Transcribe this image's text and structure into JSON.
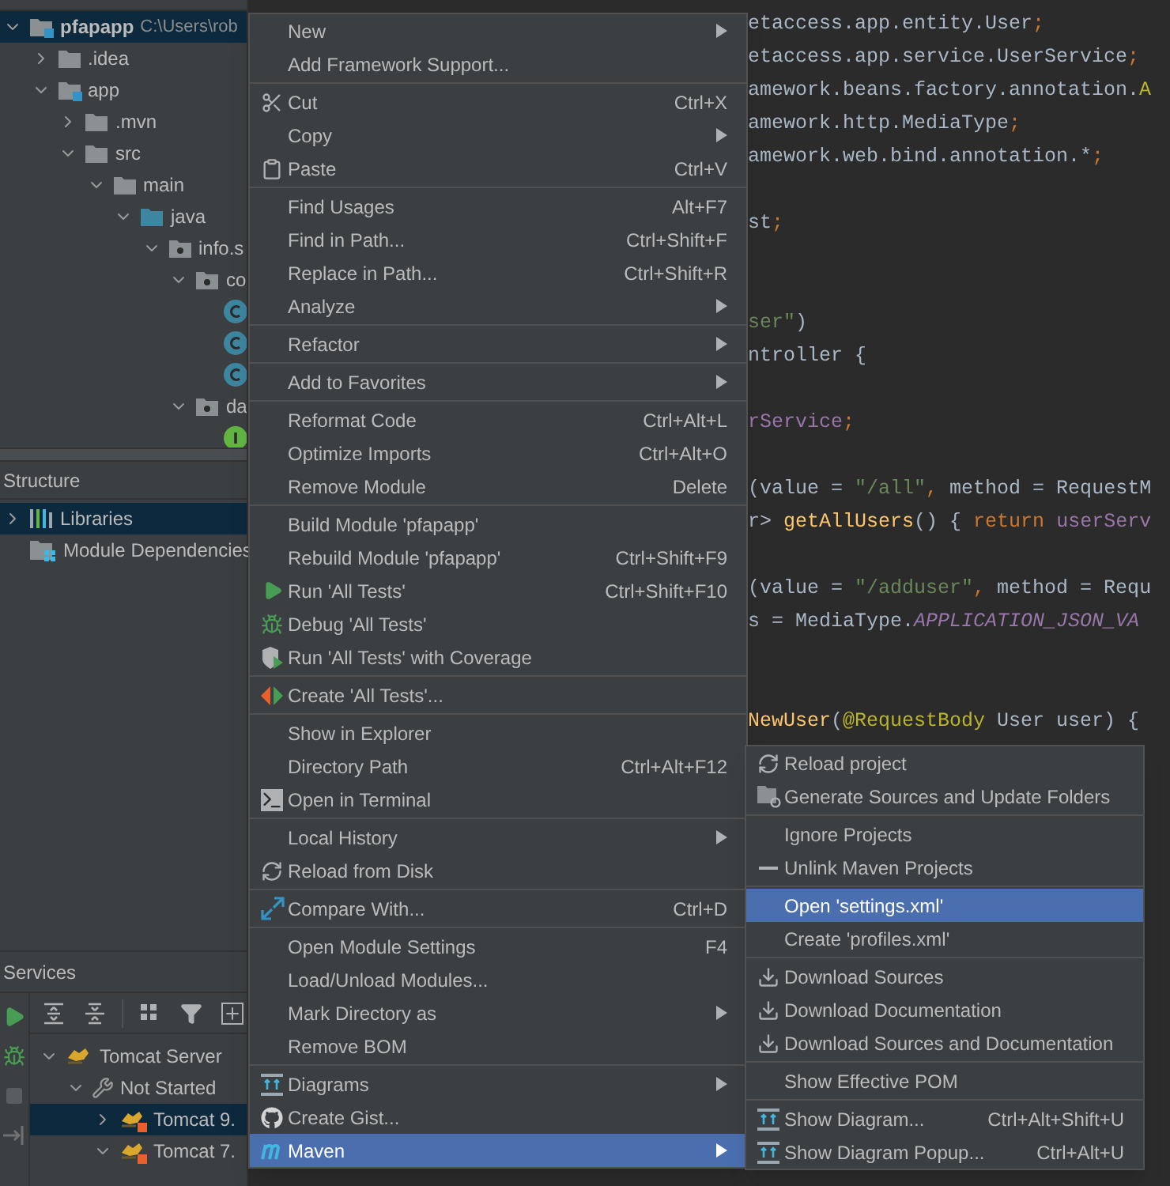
{
  "project_tree": {
    "items": [
      {
        "label": "pfapapp",
        "path": "C:\\Users\\rob",
        "kind": "module",
        "expanded": true,
        "selected": true,
        "children": [
          {
            "label": ".idea",
            "kind": "folder",
            "expanded": false,
            "selected": false
          },
          {
            "label": "app",
            "kind": "module",
            "expanded": true,
            "selected": false,
            "children": [
              {
                "label": ".mvn",
                "kind": "folder",
                "expanded": false,
                "selected": false
              },
              {
                "label": "src",
                "kind": "folder",
                "expanded": true,
                "selected": false,
                "children": [
                  {
                    "label": "main",
                    "kind": "folder",
                    "expanded": true,
                    "selected": false,
                    "children": [
                      {
                        "label": "java",
                        "kind": "source_root",
                        "expanded": true,
                        "selected": false,
                        "children": [
                          {
                            "label": "info.s",
                            "kind": "package",
                            "expanded": true,
                            "selected": false,
                            "children": [
                              {
                                "label": "co",
                                "kind": "package",
                                "expanded": true,
                                "selected": false,
                                "children": [
                                  {
                                    "kind": "class",
                                    "selected": false
                                  },
                                  {
                                    "kind": "class",
                                    "selected": false
                                  },
                                  {
                                    "kind": "class",
                                    "selected": false
                                  }
                                ]
                              },
                              {
                                "label": "da",
                                "kind": "package",
                                "expanded": true,
                                "selected": false,
                                "children": [
                                  {
                                    "kind": "interface",
                                    "selected": false
                                  }
                                ]
                              }
                            ]
                          }
                        ]
                      }
                    ]
                  }
                ]
              }
            ]
          }
        ]
      }
    ]
  },
  "structure": {
    "title": "Structure",
    "items": [
      {
        "label": "Libraries",
        "kind": "libraries",
        "expanded": false,
        "selected": true
      },
      {
        "label": "Module Dependencies",
        "kind": "dependencies",
        "selected": false
      }
    ]
  },
  "services": {
    "title": "Services",
    "items": [
      {
        "label": "Tomcat Server",
        "kind": "server",
        "expanded": true,
        "selected": false,
        "children": [
          {
            "label": "Not Started",
            "kind": "status",
            "expanded": true,
            "selected": false,
            "children": [
              {
                "label": "Tomcat 9.",
                "kind": "tomcat",
                "expanded": false,
                "selected": true
              },
              {
                "label": "Tomcat 7.",
                "kind": "tomcat",
                "expanded": true,
                "selected": false
              }
            ]
          }
        ]
      }
    ]
  },
  "editor": {
    "lines": [
      {
        "kind": "code",
        "tokens": [
          {
            "kind": "plain",
            "text": "etaccess.app.entity.User"
          },
          {
            "kind": "keyword",
            "text": ";"
          }
        ]
      },
      {
        "kind": "code",
        "tokens": [
          {
            "kind": "plain",
            "text": "etaccess.app.service.UserService"
          },
          {
            "kind": "keyword",
            "text": ";"
          }
        ]
      },
      {
        "kind": "code",
        "tokens": [
          {
            "kind": "plain",
            "text": "amework.beans.factory.annotation."
          },
          {
            "kind": "annotation",
            "text": "A"
          }
        ]
      },
      {
        "kind": "code",
        "tokens": [
          {
            "kind": "plain",
            "text": "amework.http.MediaType"
          },
          {
            "kind": "keyword",
            "text": ";"
          }
        ]
      },
      {
        "kind": "code",
        "tokens": [
          {
            "kind": "plain",
            "text": "amework.web.bind.annotation.*"
          },
          {
            "kind": "keyword",
            "text": ";"
          }
        ]
      },
      {
        "kind": "blank"
      },
      {
        "kind": "code",
        "tokens": [
          {
            "kind": "plain",
            "text": "st"
          },
          {
            "kind": "keyword",
            "text": ";"
          }
        ]
      },
      {
        "kind": "blank"
      },
      {
        "kind": "blank"
      },
      {
        "kind": "code",
        "tokens": [
          {
            "kind": "string",
            "text": "ser\""
          },
          {
            "kind": "plain",
            "text": ")"
          }
        ]
      },
      {
        "kind": "code",
        "tokens": [
          {
            "kind": "plain",
            "text": "ntroller {"
          }
        ]
      },
      {
        "kind": "blank"
      },
      {
        "kind": "code",
        "tokens": [
          {
            "kind": "field",
            "text": "rService"
          },
          {
            "kind": "keyword",
            "text": ";"
          }
        ]
      },
      {
        "kind": "blank"
      },
      {
        "kind": "code",
        "tokens": [
          {
            "kind": "plain",
            "text": "(value = "
          },
          {
            "kind": "string",
            "text": "\"/all\""
          },
          {
            "kind": "keyword",
            "text": ","
          },
          {
            "kind": "plain",
            "text": " method = RequestM"
          }
        ]
      },
      {
        "kind": "code",
        "tokens": [
          {
            "kind": "plain",
            "text": "r> "
          },
          {
            "kind": "method",
            "text": "getAllUsers"
          },
          {
            "kind": "plain",
            "text": "() { "
          },
          {
            "kind": "keyword",
            "text": "return "
          },
          {
            "kind": "field",
            "text": "userServ"
          }
        ]
      },
      {
        "kind": "blank"
      },
      {
        "kind": "code",
        "tokens": [
          {
            "kind": "plain",
            "text": "(value = "
          },
          {
            "kind": "string",
            "text": "\"/adduser\""
          },
          {
            "kind": "keyword",
            "text": ","
          },
          {
            "kind": "plain",
            "text": " method = Requ"
          }
        ]
      },
      {
        "kind": "code",
        "tokens": [
          {
            "kind": "plain",
            "text": "s = MediaType."
          },
          {
            "kind": "constant",
            "text": "APPLICATION_JSON_VA"
          }
        ]
      },
      {
        "kind": "blank"
      },
      {
        "kind": "blank"
      },
      {
        "kind": "code",
        "tokens": [
          {
            "kind": "method",
            "text": "NewUser"
          },
          {
            "kind": "plain",
            "text": "("
          },
          {
            "kind": "annotation",
            "text": "@RequestBody"
          },
          {
            "kind": "plain",
            "text": " User user) {"
          }
        ]
      }
    ]
  },
  "context_menu": {
    "items": [
      {
        "kind": "item",
        "label": "New",
        "has_submenu": true,
        "selected": false
      },
      {
        "kind": "item",
        "label": "Add Framework Support...",
        "has_submenu": false,
        "selected": false
      },
      {
        "kind": "separator"
      },
      {
        "kind": "item",
        "label": "Cut",
        "shortcut": "Ctrl+X",
        "has_submenu": false,
        "selected": false
      },
      {
        "kind": "item",
        "label": "Copy",
        "has_submenu": true,
        "selected": false
      },
      {
        "kind": "item",
        "label": "Paste",
        "shortcut": "Ctrl+V",
        "has_submenu": false,
        "selected": false
      },
      {
        "kind": "separator"
      },
      {
        "kind": "item",
        "label": "Find Usages",
        "shortcut": "Alt+F7",
        "has_submenu": false,
        "selected": false
      },
      {
        "kind": "item",
        "label": "Find in Path...",
        "shortcut": "Ctrl+Shift+F",
        "has_submenu": false,
        "selected": false
      },
      {
        "kind": "item",
        "label": "Replace in Path...",
        "shortcut": "Ctrl+Shift+R",
        "has_submenu": false,
        "selected": false
      },
      {
        "kind": "item",
        "label": "Analyze",
        "has_submenu": true,
        "selected": false
      },
      {
        "kind": "separator"
      },
      {
        "kind": "item",
        "label": "Refactor",
        "has_submenu": true,
        "selected": false
      },
      {
        "kind": "separator"
      },
      {
        "kind": "item",
        "label": "Add to Favorites",
        "has_submenu": true,
        "selected": false
      },
      {
        "kind": "separator"
      },
      {
        "kind": "item",
        "label": "Reformat Code",
        "shortcut": "Ctrl+Alt+L",
        "has_submenu": false,
        "selected": false
      },
      {
        "kind": "item",
        "label": "Optimize Imports",
        "shortcut": "Ctrl+Alt+O",
        "has_submenu": false,
        "selected": false
      },
      {
        "kind": "item",
        "label": "Remove Module",
        "shortcut": "Delete",
        "has_submenu": false,
        "selected": false
      },
      {
        "kind": "separator"
      },
      {
        "kind": "item",
        "label": "Build Module 'pfapapp'",
        "has_submenu": false,
        "selected": false
      },
      {
        "kind": "item",
        "label": "Rebuild Module 'pfapapp'",
        "shortcut": "Ctrl+Shift+F9",
        "has_submenu": false,
        "selected": false
      },
      {
        "kind": "item",
        "label": "Run 'All Tests'",
        "shortcut": "Ctrl+Shift+F10",
        "has_submenu": false,
        "selected": false
      },
      {
        "kind": "item",
        "label": "Debug 'All Tests'",
        "has_submenu": false,
        "selected": false
      },
      {
        "kind": "item",
        "label": "Run 'All Tests' with Coverage",
        "has_submenu": false,
        "selected": false
      },
      {
        "kind": "separator"
      },
      {
        "kind": "item",
        "label": "Create 'All Tests'...",
        "has_submenu": false,
        "selected": false
      },
      {
        "kind": "separator"
      },
      {
        "kind": "item",
        "label": "Show in Explorer",
        "has_submenu": false,
        "selected": false
      },
      {
        "kind": "item",
        "label": "Directory Path",
        "shortcut": "Ctrl+Alt+F12",
        "has_submenu": false,
        "selected": false
      },
      {
        "kind": "item",
        "label": "Open in Terminal",
        "has_submenu": false,
        "selected": false
      },
      {
        "kind": "separator"
      },
      {
        "kind": "item",
        "label": "Local History",
        "has_submenu": true,
        "selected": false
      },
      {
        "kind": "item",
        "label": "Reload from Disk",
        "has_submenu": false,
        "selected": false
      },
      {
        "kind": "separator"
      },
      {
        "kind": "item",
        "label": "Compare With...",
        "shortcut": "Ctrl+D",
        "has_submenu": false,
        "selected": false
      },
      {
        "kind": "separator"
      },
      {
        "kind": "item",
        "label": "Open Module Settings",
        "shortcut": "F4",
        "has_submenu": false,
        "selected": false
      },
      {
        "kind": "item",
        "label": "Load/Unload Modules...",
        "has_submenu": false,
        "selected": false
      },
      {
        "kind": "item",
        "label": "Mark Directory as",
        "has_submenu": true,
        "selected": false
      },
      {
        "kind": "item",
        "label": "Remove BOM",
        "has_submenu": false,
        "selected": false
      },
      {
        "kind": "separator"
      },
      {
        "kind": "item",
        "label": "Diagrams",
        "has_submenu": true,
        "selected": false
      },
      {
        "kind": "item",
        "label": "Create Gist...",
        "has_submenu": false,
        "selected": false
      },
      {
        "kind": "item",
        "label": "Maven",
        "has_submenu": true,
        "selected": true
      }
    ]
  },
  "maven_submenu": {
    "items": [
      {
        "kind": "item",
        "label": "Reload project",
        "selected": false
      },
      {
        "kind": "item",
        "label": "Generate Sources and Update Folders",
        "selected": false
      },
      {
        "kind": "separator"
      },
      {
        "kind": "item",
        "label": "Ignore Projects",
        "selected": false
      },
      {
        "kind": "item",
        "label": "Unlink Maven Projects",
        "selected": false
      },
      {
        "kind": "separator"
      },
      {
        "kind": "item",
        "label": "Open 'settings.xml'",
        "selected": true
      },
      {
        "kind": "item",
        "label": "Create 'profiles.xml'",
        "selected": false
      },
      {
        "kind": "separator"
      },
      {
        "kind": "item",
        "label": "Download Sources",
        "selected": false
      },
      {
        "kind": "item",
        "label": "Download Documentation",
        "selected": false
      },
      {
        "kind": "item",
        "label": "Download Sources and Documentation",
        "selected": false
      },
      {
        "kind": "separator"
      },
      {
        "kind": "item",
        "label": "Show Effective POM",
        "selected": false
      },
      {
        "kind": "separator"
      },
      {
        "kind": "item",
        "label": "Show Diagram...",
        "shortcut": "Ctrl+Alt+Shift+U",
        "selected": false
      },
      {
        "kind": "item",
        "label": "Show Diagram Popup...",
        "shortcut": "Ctrl+Alt+U",
        "selected": false
      }
    ]
  }
}
